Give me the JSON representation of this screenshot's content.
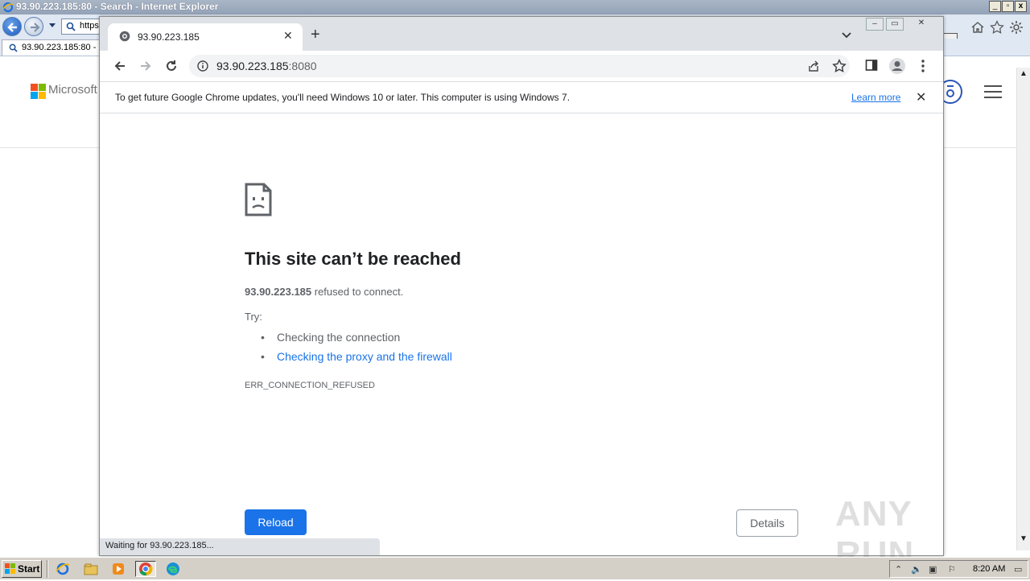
{
  "ie": {
    "title": "93.90.223.185:80 - Search - Internet Explorer",
    "address_value": "https:",
    "tab_label": "93.90.223.185:80 -",
    "brand_text": "Microsoft"
  },
  "chrome": {
    "tab_title": "93.90.223.185",
    "omnibox_host": "93.90.223.185",
    "omnibox_port": ":8080",
    "infobar_message": "To get future Google Chrome updates, you'll need Windows 10 or later. This computer is using Windows 7.",
    "infobar_link": "Learn more",
    "error": {
      "title": "This site can’t be reached",
      "host": "93.90.223.185",
      "description": " refused to connect.",
      "try_label": "Try:",
      "suggestions": [
        "Checking the connection",
        "Checking the proxy and the firewall"
      ],
      "code": "ERR_CONNECTION_REFUSED"
    },
    "reload_label": "Reload",
    "details_label": "Details",
    "status_text": "Waiting for 93.90.223.185..."
  },
  "watermark": "ANY RUN",
  "taskbar": {
    "start_label": "Start",
    "clock": "8:20 AM"
  },
  "colors": {
    "chrome_blue": "#1a73e8",
    "tabstrip": "#dee1e6",
    "taskbar": "#d4d0c8"
  }
}
